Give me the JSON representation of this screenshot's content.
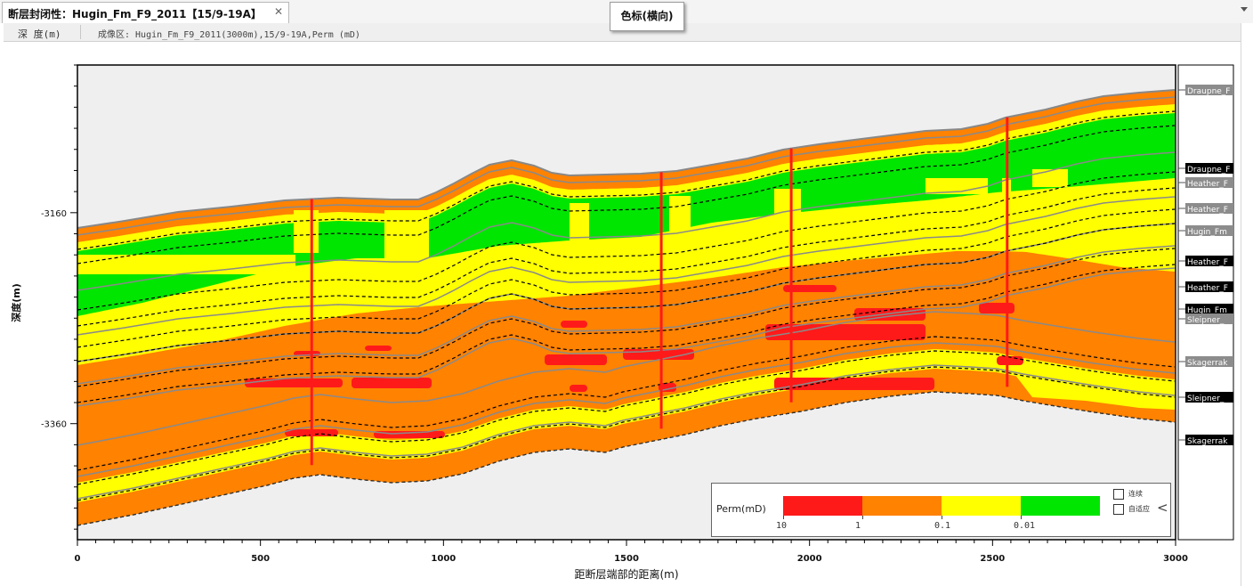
{
  "tab": {
    "title": "断层封闭性：Hugin_Fm_F9_2011【15/9-19A】",
    "close_icon": "close-icon"
  },
  "tooltip": "色标(横向)",
  "info": {
    "depth_tab": "深 度(m)",
    "imaging": "成像区: Hugin_Fm_F9_2011(3000m),15/9-19A,Perm (mD)"
  },
  "colors": {
    "red": "#ff1a1a",
    "orange": "#ff8200",
    "yellow": "#ffff00",
    "green": "#00e600",
    "plot_bg": "#efefef"
  },
  "chart_data": {
    "type": "heatmap",
    "title": "",
    "xlabel": "距断层端部的距离(m)",
    "ylabel": "深度(m)",
    "x_ticks": [
      "0",
      "500",
      "1000",
      "1500",
      "2000",
      "2500",
      "3000"
    ],
    "xlim": [
      0,
      3000
    ],
    "y_ticks": [
      "-3160",
      "-3360"
    ],
    "ylim": [
      -3470,
      -3020
    ],
    "right_labels": [
      {
        "text": "Draupne_F",
        "style": "grey"
      },
      {
        "text": "Draupne_F",
        "style": "black"
      },
      {
        "text": "Heather_F",
        "style": "grey"
      },
      {
        "text": "Heather_F",
        "style": "grey"
      },
      {
        "text": "Hugin_Fm",
        "style": "grey"
      },
      {
        "text": "Heather_F",
        "style": "black"
      },
      {
        "text": "Heather_F",
        "style": "black"
      },
      {
        "text": "Hugin_Fm",
        "style": "black"
      },
      {
        "text": "Sleipner_",
        "style": "grey"
      },
      {
        "text": "Skagerrak",
        "style": "grey"
      },
      {
        "text": "Sleipner_",
        "style": "black"
      },
      {
        "text": "Skagerrak",
        "style": "black"
      }
    ],
    "wells_x": [
      640,
      1595,
      1950,
      2540
    ],
    "colorbar": {
      "label": "Perm(mD)",
      "classes": [
        {
          "range": ">10",
          "color": "red"
        },
        {
          "range": "1-10",
          "color": "orange"
        },
        {
          "range": "0.1-1",
          "color": "yellow"
        },
        {
          "range": "0.01-0.1",
          "color": "green"
        }
      ],
      "tick_labels": [
        "10",
        "1",
        "0.1",
        "0.01"
      ]
    }
  },
  "legend": {
    "checkbox1": "连续",
    "checkbox2": "自适应"
  }
}
